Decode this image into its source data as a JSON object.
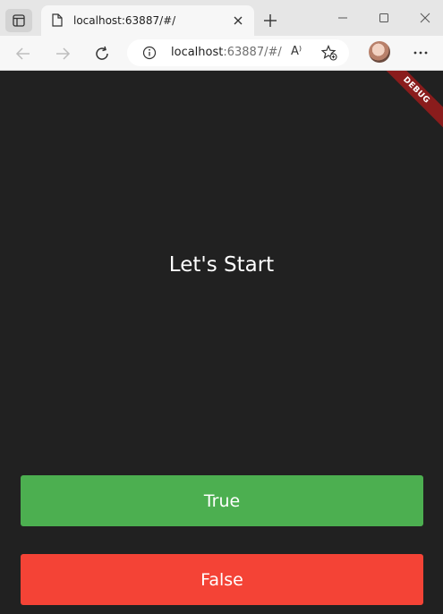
{
  "browser": {
    "tab": {
      "title": "localhost:63887/#/"
    },
    "address": {
      "host": "localhost",
      "rest": ":63887/#/"
    },
    "read_aloud_label": "A⁾"
  },
  "app": {
    "question": "Let's Start",
    "buttons": {
      "true_label": "True",
      "false_label": "False"
    },
    "debug_label": "DEBUG"
  },
  "colors": {
    "background": "#212121",
    "true_button": "#4caf50",
    "false_button": "#f44336",
    "debug_banner": "#8a1c1c"
  }
}
